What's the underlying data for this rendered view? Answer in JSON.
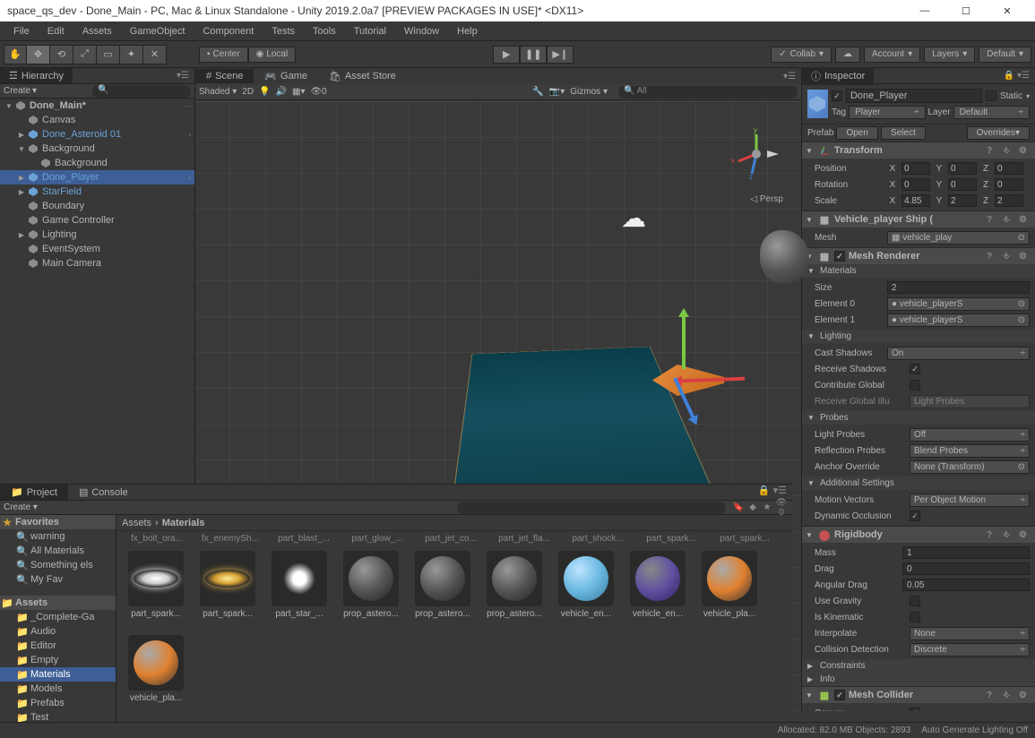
{
  "window": {
    "title": "space_qs_dev - Done_Main - PC, Mac & Linux Standalone - Unity 2019.2.0a7 [PREVIEW PACKAGES IN USE]* <DX11>"
  },
  "menubar": [
    "File",
    "Edit",
    "Assets",
    "GameObject",
    "Component",
    "Tests",
    "Tools",
    "Tutorial",
    "Window",
    "Help"
  ],
  "toolbar": {
    "pivot": {
      "center": "Center",
      "local": "Local"
    },
    "collab": "Collab",
    "account": "Account",
    "layers": "Layers",
    "layout": "Default"
  },
  "hierarchy": {
    "title": "Hierarchy",
    "create": "Create",
    "scene": "Done_Main*",
    "items": [
      {
        "label": "Canvas",
        "depth": 1,
        "kind": "go"
      },
      {
        "label": "Done_Asteroid 01",
        "depth": 1,
        "kind": "prefab",
        "arrow": true,
        "chev": true
      },
      {
        "label": "Background",
        "depth": 1,
        "kind": "go",
        "arrow": "down"
      },
      {
        "label": "Background",
        "depth": 2,
        "kind": "go"
      },
      {
        "label": "Done_Player",
        "depth": 1,
        "kind": "prefab",
        "arrow": true,
        "selected": true,
        "chev": true
      },
      {
        "label": "StarField",
        "depth": 1,
        "kind": "prefab",
        "arrow": true
      },
      {
        "label": "Boundary",
        "depth": 1,
        "kind": "go"
      },
      {
        "label": "Game Controller",
        "depth": 1,
        "kind": "go"
      },
      {
        "label": "Lighting",
        "depth": 1,
        "kind": "go",
        "arrow": true
      },
      {
        "label": "EventSystem",
        "depth": 1,
        "kind": "go"
      },
      {
        "label": "Main Camera",
        "depth": 1,
        "kind": "go"
      }
    ]
  },
  "scene": {
    "tabs": {
      "scene": "Scene",
      "game": "Game",
      "asset_store": "Asset Store"
    },
    "toolbar": {
      "shading": "Shaded",
      "mode2d": "2D",
      "gizmos": "Gizmos",
      "search": "All"
    },
    "persp": "Persp"
  },
  "inspector": {
    "title": "Inspector",
    "name": "Done_Player",
    "static_label": "Static",
    "tag_label": "Tag",
    "tag_value": "Player",
    "layer_label": "Layer",
    "layer_value": "Default",
    "prefab": {
      "label": "Prefab",
      "open": "Open",
      "select": "Select",
      "overrides": "Overrides"
    },
    "transform": {
      "title": "Transform",
      "position": {
        "label": "Position",
        "x": "0",
        "y": "0",
        "z": "0"
      },
      "rotation": {
        "label": "Rotation",
        "x": "0",
        "y": "0",
        "z": "0"
      },
      "scale": {
        "label": "Scale",
        "x": "4.85",
        "y": "2",
        "z": "2"
      }
    },
    "meshfilter": {
      "title": "Vehicle_player Ship (",
      "mesh_label": "Mesh",
      "mesh_value": "vehicle_play"
    },
    "meshrenderer": {
      "title": "Mesh Renderer",
      "materials": "Materials",
      "size_label": "Size",
      "size": "2",
      "element0_label": "Element 0",
      "element0": "vehicle_playerS",
      "element1_label": "Element 1",
      "element1": "vehicle_playerS",
      "lighting": "Lighting",
      "cast_shadows_label": "Cast Shadows",
      "cast_shadows": "On",
      "receive_shadows": "Receive Shadows",
      "contribute_global": "Contribute Global",
      "receive_global": "Receive Global Illu",
      "receive_global_value": "Light Probes",
      "probes": "Probes",
      "light_probes_label": "Light Probes",
      "light_probes": "Off",
      "reflection_probes_label": "Reflection Probes",
      "reflection_probes": "Blend Probes",
      "anchor_label": "Anchor Override",
      "anchor": "None (Transform)",
      "additional": "Additional Settings",
      "motion_label": "Motion Vectors",
      "motion": "Per Object Motion",
      "dynamic_occlusion": "Dynamic Occlusion"
    },
    "rigidbody": {
      "title": "Rigidbody",
      "mass_label": "Mass",
      "mass": "1",
      "drag_label": "Drag",
      "drag": "0",
      "angular_drag_label": "Angular Drag",
      "angular_drag": "0.05",
      "use_gravity": "Use Gravity",
      "is_kinematic": "Is Kinematic",
      "interpolate_label": "Interpolate",
      "interpolate": "None",
      "collision_label": "Collision Detection",
      "collision": "Discrete",
      "constraints": "Constraints",
      "info": "Info"
    },
    "meshcollider": {
      "title": "Mesh Collider",
      "convex": "Convex"
    }
  },
  "project": {
    "title": "Project",
    "console": "Console",
    "create": "Create",
    "vis_count": "0",
    "favorites": {
      "title": "Favorites",
      "items": [
        "warning",
        "All Materials",
        "Something els",
        "My Fav"
      ]
    },
    "assets": {
      "title": "Assets",
      "folders": [
        "_Complete-Ga",
        "Audio",
        "Editor",
        "Empty",
        "Materials",
        "Models",
        "Prefabs",
        "Test"
      ]
    },
    "breadcrumb": {
      "root": "Assets",
      "current": "Materials"
    },
    "labels_row": [
      "fx_bolt_ora...",
      "fx_enemySh...",
      "part_blast_...",
      "part_glow_...",
      "part_jet_co...",
      "part_jet_fla...",
      "part_shock...",
      "part_spark...",
      "part_spark..."
    ],
    "grid": [
      {
        "name": "part_spark...",
        "style": "glow-white"
      },
      {
        "name": "part_spark...",
        "style": "glow-yellow"
      },
      {
        "name": "part_star_...",
        "style": "star"
      },
      {
        "name": "prop_astero...",
        "style": "sphere asteroid-sphere"
      },
      {
        "name": "prop_astero...",
        "style": "sphere asteroid-sphere"
      },
      {
        "name": "prop_astero...",
        "style": "sphere asteroid-sphere"
      },
      {
        "name": "vehicle_en...",
        "style": "sphere blue-sphere"
      },
      {
        "name": "vehicle_en...",
        "style": "sphere purple-sphere"
      },
      {
        "name": "vehicle_pla...",
        "style": "sphere player-sphere"
      },
      {
        "name": "vehicle_pla...",
        "style": "sphere player-sphere"
      }
    ]
  },
  "statusbar": {
    "alloc": "Allocated: 82.0 MB Objects: 2893",
    "lighting": "Auto Generate Lighting Off"
  }
}
